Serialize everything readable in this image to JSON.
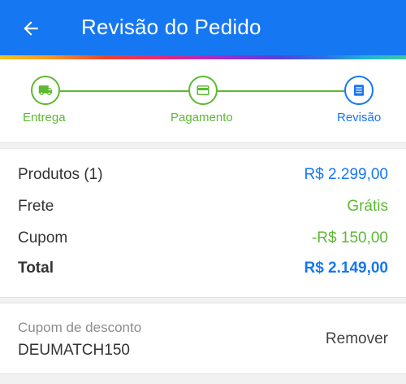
{
  "header": {
    "title": "Revisão do Pedido",
    "back_icon": "arrow-left-icon",
    "background": "#1677f2"
  },
  "stepper": {
    "steps": [
      {
        "label": "Entrega",
        "icon": "truck-icon",
        "state": "done"
      },
      {
        "label": "Pagamento",
        "icon": "card-icon",
        "state": "done"
      },
      {
        "label": "Revisão",
        "icon": "list-icon",
        "state": "current"
      }
    ],
    "done_color": "#5cb932",
    "current_color": "#1677f2"
  },
  "summary": {
    "products_label": "Produtos (1)",
    "products_value": "R$ 2.299,00",
    "shipping_label": "Frete",
    "shipping_value": "Grátis",
    "coupon_label": "Cupom",
    "coupon_value": "-R$ 150,00",
    "total_label": "Total",
    "total_value": "R$ 2.149,00"
  },
  "coupon": {
    "label": "Cupom de desconto",
    "code": "DEUMATCH150",
    "remove_label": "Remover"
  }
}
